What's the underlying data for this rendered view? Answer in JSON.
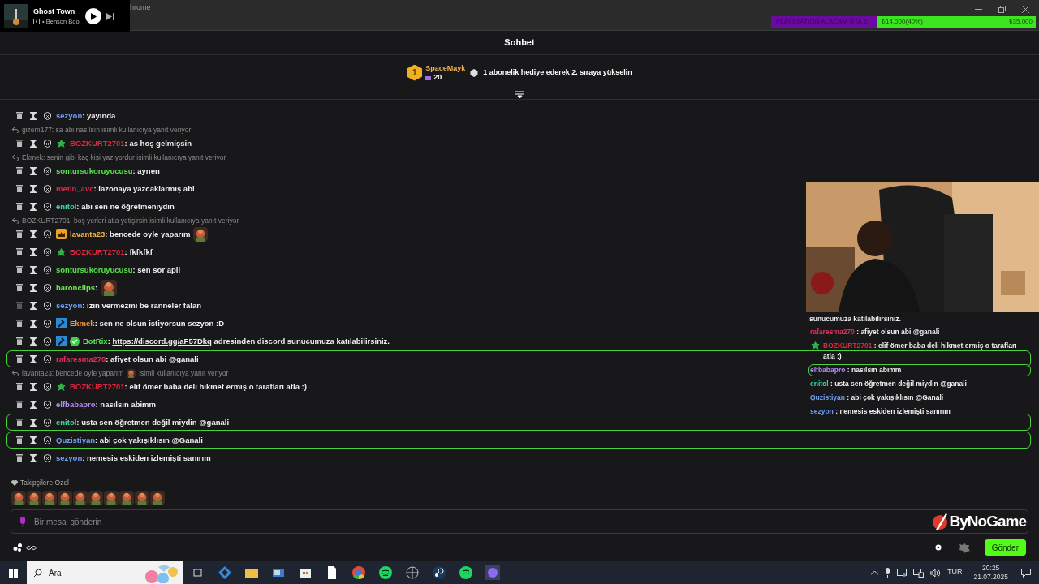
{
  "window": {
    "title_fragment": "hrome"
  },
  "player": {
    "title": "Ghost Town",
    "artist": "• Benson Boo",
    "playing": false
  },
  "goal": {
    "label": "PLAYSTATION ALACAM GTA 6",
    "amount": "₺14,000(40%)",
    "target": "₺35,000",
    "level": 0.4
  },
  "chat": {
    "title": "Sohbet",
    "pinned": {
      "rank": "1",
      "user": "SpaceMayk",
      "count": "20",
      "message": "1 abonelik hediye ederek 2. sıraya yükselin"
    },
    "messages": [
      {
        "user": "sezyon",
        "color": "#6f9cf2",
        "text": ": yayında",
        "highlighted": false,
        "dimmed_delete": false
      },
      {
        "reply": [
          {
            "kind": "text",
            "text": "gizem177: sa abi nasılsın isimli kullanıcıya yanıt veriyor"
          }
        ],
        "user": "BOZKURT2701",
        "color": "#e0263c",
        "badges": [
          {
            "kind": "sprout"
          }
        ],
        "text": ": as hoş gelmişsin",
        "highlighted": false,
        "dimmed_delete": false
      },
      {
        "reply": [
          {
            "kind": "text",
            "text": "Ekmek: senin gibi kaç kişi yazıyordur isimli kullanıcıya yanıt veriyor"
          }
        ],
        "user": "sontursukoruyucusu",
        "color": "#57e04a",
        "text": ": aynen",
        "highlighted": false,
        "dimmed_delete": false
      },
      {
        "user": "metin_avc",
        "color": "#d9254a",
        "text": ": lazonaya yazcaklarmış abi",
        "highlighted": false,
        "dimmed_delete": false
      },
      {
        "user": "enitol",
        "color": "#3fd6a0",
        "text": ": abi sen ne öğretmeniydin",
        "highlighted": false,
        "dimmed_delete": false
      },
      {
        "reply": [
          {
            "kind": "text",
            "text": "BOZKURT2701: boş yerleri atla yetişirsin isimli kullanıcıya yanıt veriyor"
          }
        ],
        "user": "lavanta23",
        "color": "#f6b64a",
        "badges": [
          {
            "kind": "crown"
          }
        ],
        "text": ": bencede oyle yaparım",
        "emote": true,
        "highlighted": false,
        "dimmed_delete": false
      },
      {
        "user": "BOZKURT2701",
        "color": "#e0263c",
        "badges": [
          {
            "kind": "sprout"
          }
        ],
        "text": ": fkfkfkf",
        "highlighted": false,
        "dimmed_delete": false
      },
      {
        "user": "sontursukoruyucusu",
        "color": "#57e04a",
        "text": ": sen sor apii",
        "highlighted": false,
        "dimmed_delete": false
      },
      {
        "user": "baronclips",
        "color": "#72e64a",
        "text": ":",
        "emote": true,
        "highlighted": false,
        "dimmed_delete": false
      },
      {
        "user": "sezyon",
        "color": "#6f9cf2",
        "text": ": izin vermezmi be ranneler falan",
        "highlighted": false,
        "dimmed_delete": true
      },
      {
        "user": "Ekmek",
        "color": "#f59a3c",
        "badges": [
          {
            "kind": "wrench"
          }
        ],
        "text": ": sen ne olsun istiyorsun sezyon :D",
        "highlighted": false,
        "dimmed_delete": false
      },
      {
        "user": "BotRix",
        "color": "#5ae65a",
        "badges": [
          {
            "kind": "wrench"
          },
          {
            "kind": "verified"
          }
        ],
        "link": ": https://discord.gg/aF57Dkq",
        "text": "adresinden discord sunucumuza katılabilirsiniz.",
        "highlighted": false,
        "dimmed_delete": false
      },
      {
        "user": "rafaresma270",
        "color": "#e0305a",
        "text": ": afiyet olsun abi @ganali",
        "highlighted": true,
        "dimmed_delete": false
      },
      {
        "reply": [
          {
            "kind": "text",
            "text": "lavanta23: bencede oyle yaparım"
          },
          {
            "kind": "emote"
          },
          {
            "kind": "text",
            "text": "isimli kullanıcıya yanıt veriyor"
          }
        ],
        "user": "BOZKURT2701",
        "color": "#e0263c",
        "badges": [
          {
            "kind": "sprout"
          }
        ],
        "text": ": elif ömer baba deli hikmet ermiş o tarafları atla :)",
        "highlighted": false,
        "dimmed_delete": false
      },
      {
        "user": "elfbabapro",
        "color": "#b48ef5",
        "text": ": nasılsın abimm",
        "highlighted": false,
        "dimmed_delete": false
      },
      {
        "user": "enitol",
        "color": "#3fd6a0",
        "text": ": usta sen öğretmen değil miydin @ganali",
        "highlighted": true,
        "dimmed_delete": false
      },
      {
        "user": "Quzistiyan",
        "color": "#6fa0f0",
        "text": ": abi çok yakışıklısın @Ganali",
        "highlighted": true,
        "dimmed_delete": false
      },
      {
        "user": "sezyon",
        "color": "#6f9cf2",
        "text": ": nemesis eskiden izlemişti sanırım",
        "highlighted": false,
        "dimmed_delete": false
      }
    ],
    "emote_section": {
      "title": "Takipçilere Özel"
    },
    "input": {
      "placeholder": "Bir mesaj gönderin"
    },
    "send_button": "Gönder"
  },
  "overlay": {
    "continuation": "sunucumuza katılabilirsiniz.",
    "logo": "ByNoGame",
    "lines": [
      {
        "user": "rafaresma270",
        "color": "#e0305a",
        "text": ": afiyet olsun abi @ganali",
        "highlighted": false
      },
      {
        "user": "BOZKURT2701",
        "color": "#e0263c",
        "badges": [
          {
            "kind": "sprout"
          }
        ],
        "text": ": elif ömer baba deli hikmet ermiş o tarafları atla :)",
        "highlighted": false
      },
      {
        "user": "elfbabapro",
        "color": "#b48ef5",
        "text": ": nasılsın abimm",
        "highlighted": true
      },
      {
        "user": "enitol",
        "color": "#3fd6a0",
        "text": ": usta sen öğretmen değil miydin @ganali",
        "highlighted": false
      },
      {
        "user": "Quzistiyan",
        "color": "#6fa0f0",
        "text": ": abi çok yakışıklısın @Ganali",
        "highlighted": false
      },
      {
        "user": "sezyon",
        "color": "#6f9cf2",
        "text": ": nemesis eskiden izlemişti sanırım",
        "highlighted": false
      }
    ]
  },
  "taskbar": {
    "search": "Ara",
    "language": "TUR",
    "time": "20:25",
    "date": "21.07.2025"
  }
}
